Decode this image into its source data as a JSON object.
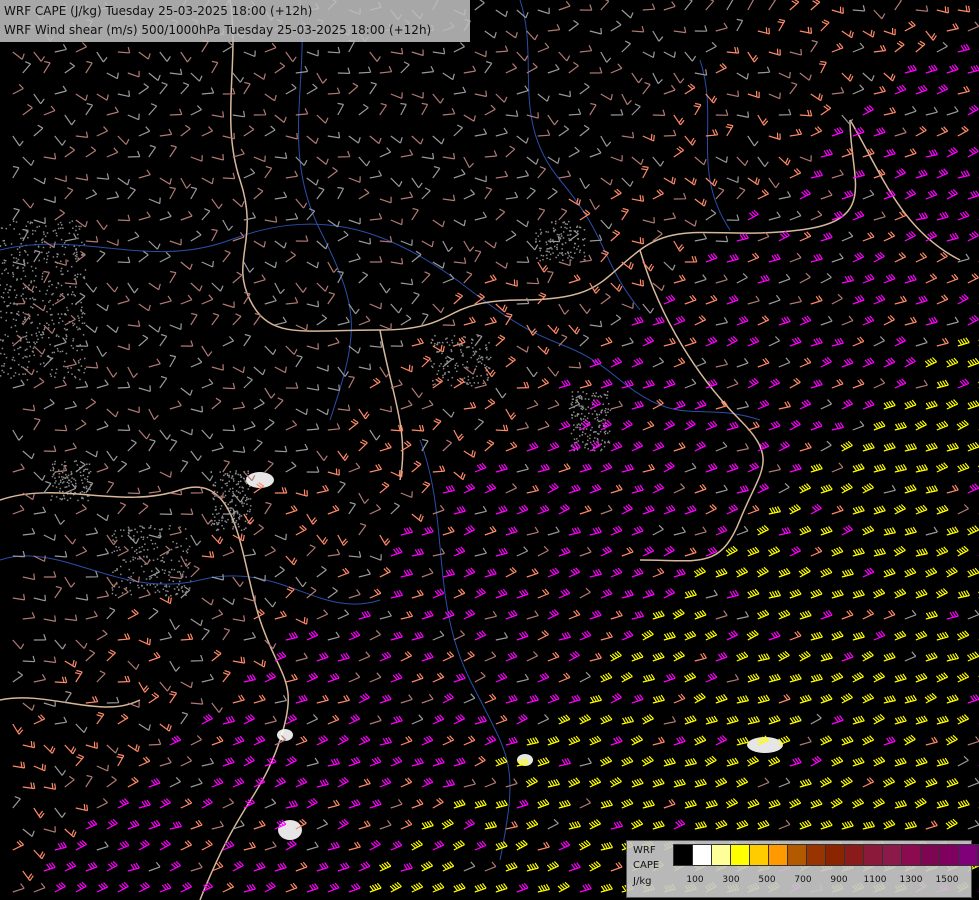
{
  "header": {
    "line1": "WRF CAPE (J/kg) Tuesday 25-03-2025 18:00 (+12h)",
    "line2": "WRF Wind shear (m/s) 500/1000hPa Tuesday 25-03-2025 18:00 (+12h)"
  },
  "legend": {
    "model": "WRF",
    "field": "CAPE",
    "unit": "J/kg",
    "swatch_colors": [
      "#000000",
      "#ffffff",
      "#ffff99",
      "#ffff00",
      "#ffcc00",
      "#ff9900",
      "#b35900",
      "#993300",
      "#8b2500",
      "#8b1a1a",
      "#8b1a3a",
      "#8b1a4a",
      "#8b0a50",
      "#7d0552",
      "#800060",
      "#80007a",
      "#6b006b"
    ],
    "tick_labels": [
      "100",
      "300",
      "500",
      "700",
      "900",
      "1100",
      "1300",
      "1500"
    ]
  },
  "style": {
    "background": "#000000",
    "border_color": "#d8b89a",
    "river_color": "#2a4ea8",
    "barb_colors": [
      "#ff00ff",
      "#ffff00",
      "#ff8a6a",
      "#b07a74",
      "#9a9a9a"
    ]
  }
}
